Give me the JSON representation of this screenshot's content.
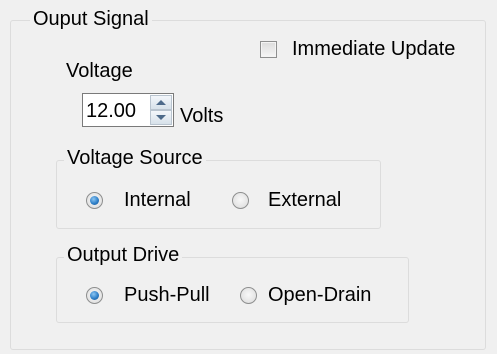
{
  "output_signal": {
    "title": "Ouput Signal",
    "immediate_update": {
      "label": "Immediate Update",
      "checked": false
    },
    "voltage": {
      "label": "Voltage",
      "value": "12.00",
      "unit": "Volts"
    },
    "voltage_source": {
      "title": "Voltage Source",
      "options": [
        {
          "label": "Internal",
          "selected": true
        },
        {
          "label": "External",
          "selected": false
        }
      ]
    },
    "output_drive": {
      "title": "Output Drive",
      "options": [
        {
          "label": "Push-Pull",
          "selected": true
        },
        {
          "label": "Open-Drain",
          "selected": false
        }
      ]
    }
  }
}
